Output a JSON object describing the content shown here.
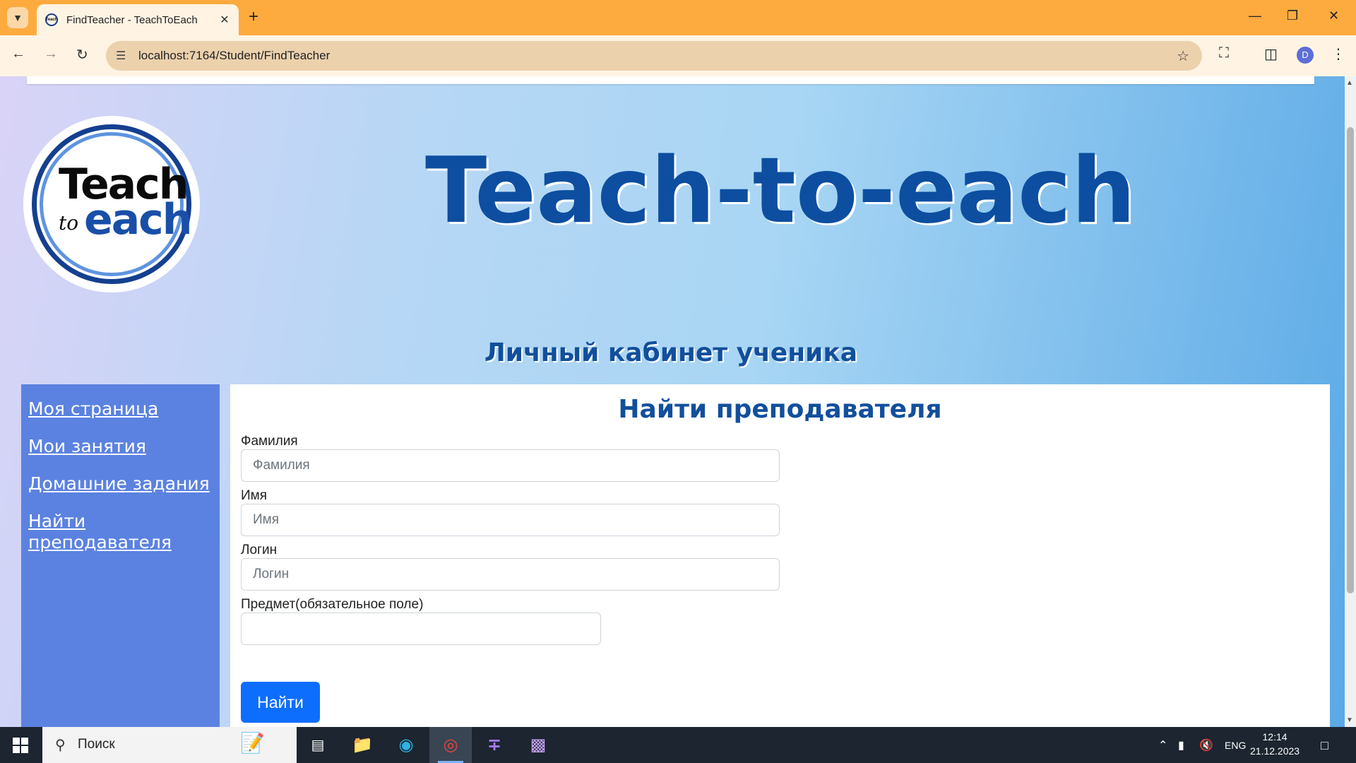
{
  "browser": {
    "tab_title": "FindTeacher - TeachToEach",
    "favicon_text": "Teach",
    "url": "localhost:7164/Student/FindTeacher",
    "profile_initial": "D"
  },
  "header": {
    "logo_teach": "Teach",
    "logo_to": "to",
    "logo_each": "each",
    "site_title": "Teach-to-each",
    "cabinet_title": "Личный кабинет ученика"
  },
  "sidebar": {
    "items": [
      {
        "label": "Моя страница"
      },
      {
        "label": "Мои занятия"
      },
      {
        "label": "Домашние задания"
      },
      {
        "label": "Найти преподавателя"
      }
    ]
  },
  "form": {
    "heading": "Найти преподавателя",
    "lastname": {
      "label": "Фамилия",
      "placeholder": "Фамилия",
      "value": ""
    },
    "firstname": {
      "label": "Имя",
      "placeholder": "Имя",
      "value": ""
    },
    "login": {
      "label": "Логин",
      "placeholder": "Логин",
      "value": ""
    },
    "subject": {
      "label": "Предмет(обязательное поле)",
      "value": ""
    },
    "submit_label": "Найти"
  },
  "taskbar": {
    "search_text": "Поиск",
    "language": "ENG",
    "time": "12:14",
    "date": "21.12.2023"
  },
  "colors": {
    "brand_dark_blue": "#0d4ea0",
    "sidebar_blue": "#5b82e0",
    "primary_button": "#0d6efd",
    "tabbar_orange": "#fdab3f"
  }
}
